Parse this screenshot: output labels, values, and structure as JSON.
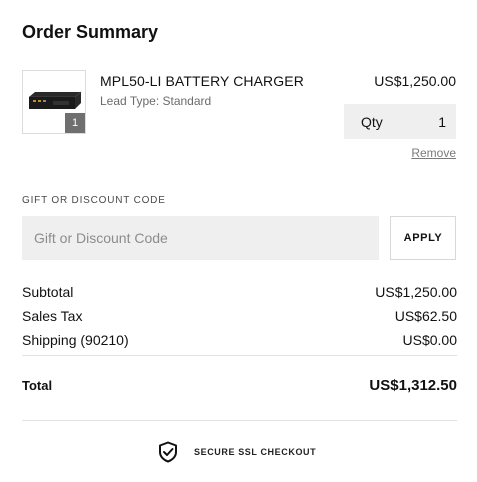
{
  "summary": {
    "title": "Order Summary"
  },
  "item": {
    "name": "MPL50-LI BATTERY CHARGER",
    "variant": "Lead Type: Standard",
    "price": "US$1,250.00",
    "badge_qty": "1",
    "qty_label": "Qty",
    "qty_value": "1",
    "remove_label": "Remove",
    "image_icon": "battery-charger-product-image"
  },
  "discount": {
    "label": "GIFT OR DISCOUNT CODE",
    "placeholder": "Gift or Discount Code",
    "value": "",
    "apply_label": "APPLY"
  },
  "totals": {
    "subtotal_label": "Subtotal",
    "subtotal_value": "US$1,250.00",
    "tax_label": "Sales Tax",
    "tax_value": "US$62.50",
    "shipping_label": "Shipping (90210)",
    "shipping_value": "US$0.00",
    "total_label": "Total",
    "total_value": "US$1,312.50"
  },
  "secure": {
    "label": "SECURE SSL CHECKOUT",
    "icon": "shield-check-icon"
  },
  "colors": {
    "text": "#111111",
    "muted": "#6b6b6b",
    "field_bg": "#efefef",
    "border": "#d8d8d8",
    "badge_bg": "#6f6f6f"
  }
}
